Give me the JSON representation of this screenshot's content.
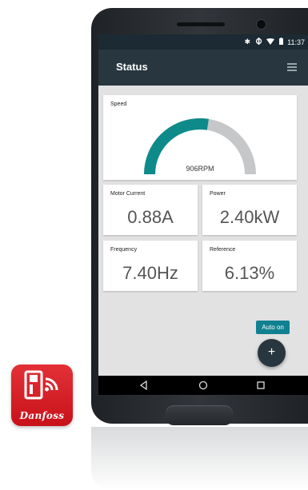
{
  "logo": {
    "brand": "Danfoss",
    "icon": "vlt-drive-wireless-icon"
  },
  "status_bar": {
    "time": "11:37",
    "icons": [
      "bluetooth-icon",
      "nfc-icon",
      "wifi-icon",
      "battery-icon"
    ]
  },
  "app_bar": {
    "title": "Status",
    "menu_icon": "hamburger-menu-icon"
  },
  "speed": {
    "label": "Speed",
    "value": "906RPM",
    "fill_fraction": 0.55,
    "fill_color": "#0f8a8a",
    "track_color": "#c5c7c8"
  },
  "tiles": [
    {
      "label": "Motor Current",
      "value": "0.88A"
    },
    {
      "label": "Power",
      "value": "2.40kW"
    },
    {
      "label": "Frequency",
      "value": "7.40Hz"
    },
    {
      "label": "Reference",
      "value": "6.13%"
    }
  ],
  "fab": {
    "tooltip": "Auto on",
    "symbol": "+"
  },
  "nav": {
    "back": "back-icon",
    "home": "home-icon",
    "recents": "recents-icon"
  }
}
